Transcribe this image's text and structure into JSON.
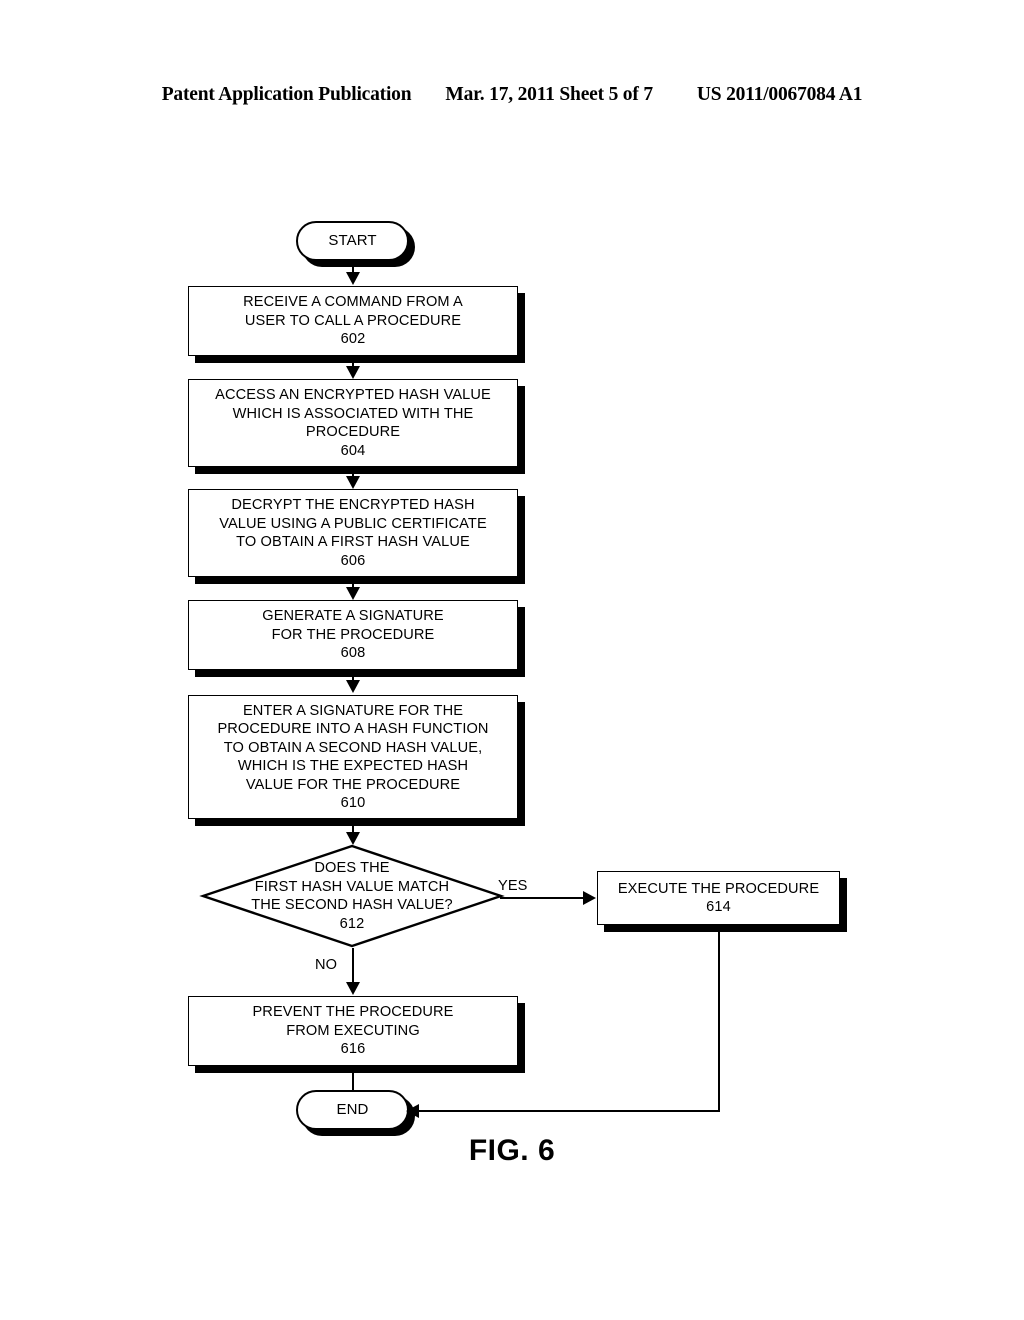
{
  "header": {
    "left": "Patent Application Publication",
    "middle": "Mar. 17, 2011  Sheet 5 of 7",
    "right": "US 2011/0067084 A1"
  },
  "figure": {
    "caption": "FIG. 6"
  },
  "flowchart": {
    "start": {
      "label": "START"
    },
    "end": {
      "label": "END"
    },
    "steps": [
      {
        "ref": "602",
        "lines": [
          "RECEIVE A COMMAND FROM A",
          "USER TO CALL A PROCEDURE"
        ]
      },
      {
        "ref": "604",
        "lines": [
          "ACCESS AN ENCRYPTED HASH VALUE",
          "WHICH IS ASSOCIATED WITH THE",
          "PROCEDURE"
        ]
      },
      {
        "ref": "606",
        "lines": [
          "DECRYPT THE ENCRYPTED HASH",
          "VALUE USING A PUBLIC CERTIFICATE",
          "TO OBTAIN A FIRST HASH VALUE"
        ]
      },
      {
        "ref": "608",
        "lines": [
          "GENERATE A SIGNATURE",
          "FOR THE PROCEDURE"
        ]
      },
      {
        "ref": "610",
        "lines": [
          "ENTER A SIGNATURE FOR THE",
          "PROCEDURE INTO A HASH FUNCTION",
          "TO OBTAIN A SECOND HASH VALUE,",
          "WHICH IS THE EXPECTED HASH",
          "VALUE FOR THE PROCEDURE"
        ]
      },
      {
        "ref": "614",
        "lines": [
          "EXECUTE THE PROCEDURE"
        ]
      },
      {
        "ref": "616",
        "lines": [
          "PREVENT THE PROCEDURE",
          "FROM EXECUTING"
        ]
      }
    ],
    "decision": {
      "ref": "612",
      "lines": [
        "DOES THE",
        "FIRST HASH VALUE MATCH",
        "THE SECOND HASH VALUE?"
      ],
      "yes_label": "YES",
      "no_label": "NO"
    }
  },
  "colors": {
    "ink": "#000000",
    "paper": "#ffffff"
  }
}
